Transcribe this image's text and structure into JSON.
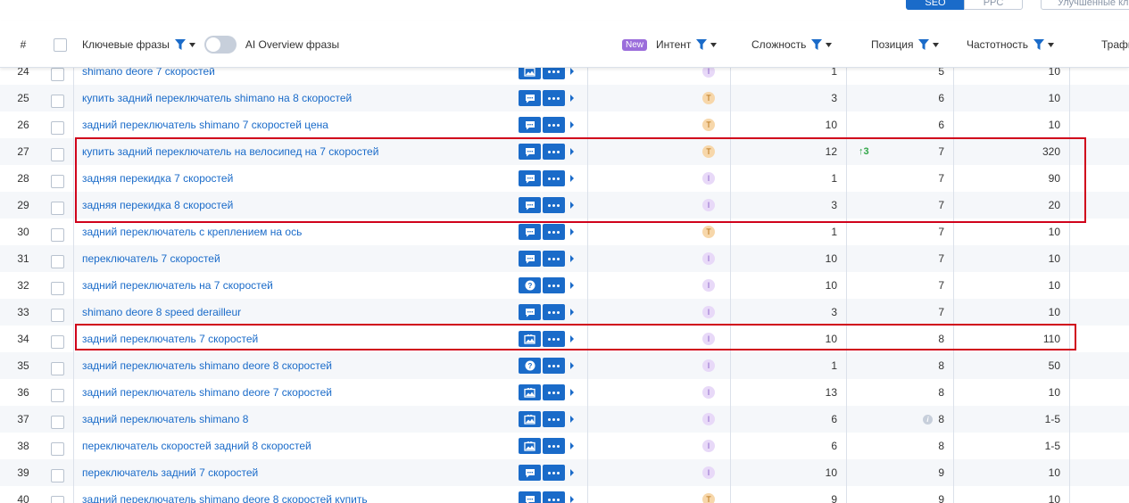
{
  "tabs": {
    "seo": "SEO",
    "ppc": "PPC",
    "advanced": "Улучшенные кл"
  },
  "header": {
    "num": "#",
    "keywords": "Ключевые фразы",
    "ai_overview": "AI Overview фразы",
    "new_badge": "New",
    "intent": "Интент",
    "difficulty": "Сложность",
    "position": "Позиция",
    "frequency": "Частотность",
    "traffic": "Трафи"
  },
  "colors": {
    "accent": "#1a6bc9",
    "highlight": "#d0021b",
    "trend_up": "#2fa547"
  },
  "rows": [
    {
      "num": "24",
      "keyword": "shimano deore 7 скоростей",
      "serp_icon": "image-icon",
      "intent": "I",
      "difficulty": "1",
      "trend": "",
      "position": "5",
      "frequency": "10"
    },
    {
      "num": "25",
      "keyword": "купить задний переключатель shimano на 8 скоростей",
      "serp_icon": "comment-icon",
      "intent": "T",
      "difficulty": "3",
      "trend": "",
      "position": "6",
      "frequency": "10"
    },
    {
      "num": "26",
      "keyword": "задний переключатель shimano 7 скоростей цена",
      "serp_icon": "comment-icon",
      "intent": "T",
      "difficulty": "10",
      "trend": "",
      "position": "6",
      "frequency": "10"
    },
    {
      "num": "27",
      "keyword": "купить задний переключатель на велосипед на 7 скоростей",
      "serp_icon": "comment-icon",
      "intent": "T",
      "difficulty": "12",
      "trend": "↑3",
      "position": "7",
      "frequency": "320"
    },
    {
      "num": "28",
      "keyword": "задняя перекидка 7 скоростей",
      "serp_icon": "comment-icon",
      "intent": "I",
      "difficulty": "1",
      "trend": "",
      "position": "7",
      "frequency": "90"
    },
    {
      "num": "29",
      "keyword": "задняя перекидка 8 скоростей",
      "serp_icon": "comment-icon",
      "intent": "I",
      "difficulty": "3",
      "trend": "",
      "position": "7",
      "frequency": "20"
    },
    {
      "num": "30",
      "keyword": "задний переключатель с креплением на ось",
      "serp_icon": "comment-icon",
      "intent": "T",
      "difficulty": "1",
      "trend": "",
      "position": "7",
      "frequency": "10"
    },
    {
      "num": "31",
      "keyword": "переключатель 7 скоростей",
      "serp_icon": "comment-icon",
      "intent": "I",
      "difficulty": "10",
      "trend": "",
      "position": "7",
      "frequency": "10"
    },
    {
      "num": "32",
      "keyword": "задний переключатель на 7 скоростей",
      "serp_icon": "question-icon",
      "intent": "I",
      "difficulty": "10",
      "trend": "",
      "position": "7",
      "frequency": "10"
    },
    {
      "num": "33",
      "keyword": "shimano deore 8 speed derailleur",
      "serp_icon": "comment-icon",
      "intent": "I",
      "difficulty": "3",
      "trend": "",
      "position": "7",
      "frequency": "10"
    },
    {
      "num": "34",
      "keyword": "задний переключатель 7 скоростей",
      "serp_icon": "image-icon",
      "intent": "I",
      "difficulty": "10",
      "trend": "",
      "position": "8",
      "frequency": "110"
    },
    {
      "num": "35",
      "keyword": "задний переключатель shimano deore 8 скоростей",
      "serp_icon": "question-icon",
      "intent": "I",
      "difficulty": "1",
      "trend": "",
      "position": "8",
      "frequency": "50"
    },
    {
      "num": "36",
      "keyword": "задний переключатель shimano deore 7 скоростей",
      "serp_icon": "image-icon",
      "intent": "I",
      "difficulty": "13",
      "trend": "",
      "position": "8",
      "frequency": "10"
    },
    {
      "num": "37",
      "keyword": "задний переключатель shimano 8",
      "serp_icon": "image-icon",
      "intent": "I",
      "difficulty": "6",
      "trend": "",
      "position": "8",
      "info": true,
      "frequency": "1-5"
    },
    {
      "num": "38",
      "keyword": "переключатель скоростей задний 8 скоростей",
      "serp_icon": "image-icon",
      "intent": "I",
      "difficulty": "6",
      "trend": "",
      "position": "8",
      "frequency": "1-5"
    },
    {
      "num": "39",
      "keyword": "переключатель задний 7 скоростей",
      "serp_icon": "comment-icon",
      "intent": "I",
      "difficulty": "10",
      "trend": "",
      "position": "9",
      "frequency": "10"
    },
    {
      "num": "40",
      "keyword": "задний переключатель shimano deore 8 скоростей купить",
      "serp_icon": "comment-icon",
      "intent": "T",
      "difficulty": "9",
      "trend": "",
      "position": "9",
      "frequency": "10"
    }
  ]
}
